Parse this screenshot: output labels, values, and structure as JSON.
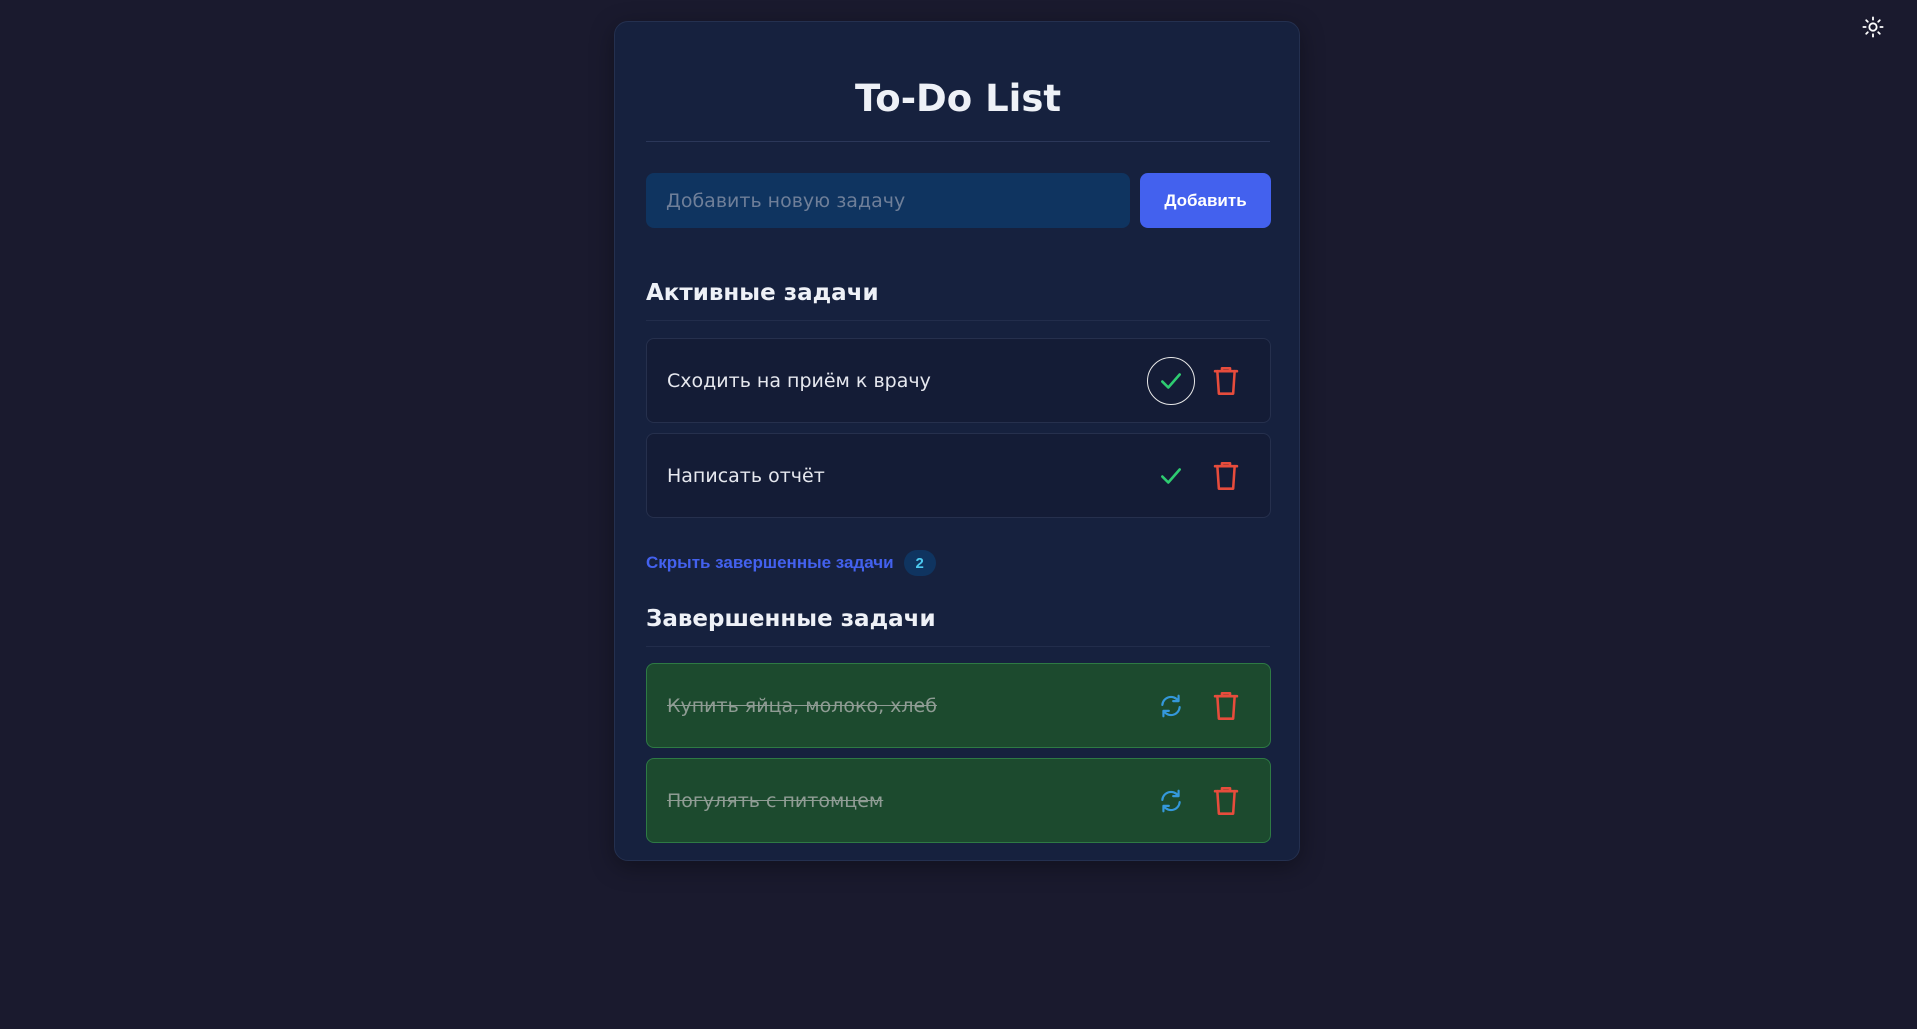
{
  "app": {
    "title": "To-Do List"
  },
  "header": {
    "theme_toggle_icon": "sun-icon"
  },
  "new_task": {
    "placeholder": "Добавить новую задачу",
    "value": "",
    "add_label": "Добавить"
  },
  "active_section": {
    "title": "Активные задачи",
    "tasks": [
      {
        "text": "Сходить на приём к врачу",
        "action_icon": "check-icon",
        "delete_icon": "trash-icon"
      },
      {
        "text": "Написать отчёт",
        "action_icon": "check-icon",
        "delete_icon": "trash-icon"
      }
    ]
  },
  "completed_toggle": {
    "label": "Скрыть завершенные задачи",
    "count": "2"
  },
  "completed_section": {
    "title": "Завершенные задачи",
    "tasks": [
      {
        "text": "Купить яйца, молоко, хлеб",
        "action_icon": "restore-icon",
        "delete_icon": "trash-icon"
      },
      {
        "text": "Погулять с питомцем",
        "action_icon": "restore-icon",
        "delete_icon": "trash-icon"
      }
    ]
  },
  "colors": {
    "page_background": "#1a1a2e",
    "card_background": "#16213e",
    "accent": "#4361ee",
    "input_background": "#0f3460",
    "complete_green": "#2ecc71",
    "delete_red": "#e74c3c",
    "restore_blue": "#3498db",
    "done_background": "#1c4a2e"
  }
}
